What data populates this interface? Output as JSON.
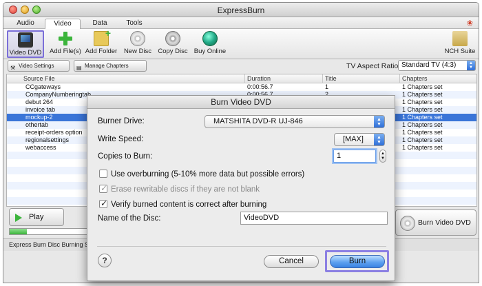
{
  "window": {
    "title": "ExpressBurn"
  },
  "menu": {
    "tabs": [
      {
        "label": "Audio"
      },
      {
        "label": "Video"
      },
      {
        "label": "Data"
      },
      {
        "label": "Tools"
      }
    ],
    "active_tab": "Video"
  },
  "toolbar": {
    "buttons": [
      {
        "label": "Video DVD",
        "icon": "film-icon"
      },
      {
        "label": "Add File(s)",
        "icon": "plus-icon"
      },
      {
        "label": "Add Folder",
        "icon": "folder-icon"
      },
      {
        "label": "New Disc",
        "icon": "disc-icon"
      },
      {
        "label": "Copy Disc",
        "icon": "copy-disc-icon"
      },
      {
        "label": "Buy Online",
        "icon": "globe-icon"
      },
      {
        "label": "NCH Suite",
        "icon": "suite-icon"
      }
    ],
    "selected": "Video DVD"
  },
  "settings": {
    "video_settings_label": "Video Settings",
    "manage_chapters_label": "Manage Chapters",
    "aspect_label": "TV Aspect Ratio:",
    "aspect_value": "Standard TV (4:3)"
  },
  "table": {
    "headers": [
      "Source File",
      "Duration",
      "Title",
      "Chapters"
    ],
    "rows": [
      {
        "source": "CCgateways",
        "duration": "0:00:56.7",
        "title": "1",
        "chapters": "1 Chapters set"
      },
      {
        "source": "CompanyNumberingtab",
        "duration": "0:00:56.7",
        "title": "2",
        "chapters": "1 Chapters set"
      },
      {
        "source": "debut 264",
        "duration": "",
        "title": "",
        "chapters": "1 Chapters set"
      },
      {
        "source": "invoice tab",
        "duration": "",
        "title": "",
        "chapters": "1 Chapters set"
      },
      {
        "source": "mockup-2",
        "duration": "",
        "title": "",
        "chapters": "1 Chapters set"
      },
      {
        "source": "othertab",
        "duration": "",
        "title": "",
        "chapters": "1 Chapters set"
      },
      {
        "source": "receipt-orders option",
        "duration": "",
        "title": "",
        "chapters": "1 Chapters set"
      },
      {
        "source": "regionalsettings",
        "duration": "",
        "title": "",
        "chapters": "1 Chapters set"
      },
      {
        "source": "webaccess",
        "duration": "",
        "title": "",
        "chapters": "1 Chapters set"
      }
    ],
    "selected_row": 4
  },
  "controls": {
    "play_label": "Play",
    "burn_video_dvd_label": "Burn Video DVD",
    "progress_fraction": 0.22
  },
  "status": {
    "text": "Express Burn Disc Burning Softw"
  },
  "dialog": {
    "title": "Burn Video DVD",
    "burner_drive_label": "Burner Drive:",
    "burner_drive_value": "MATSHITA DVD-R   UJ-846",
    "write_speed_label": "Write Speed:",
    "write_speed_value": "[MAX]",
    "copies_label": "Copies to Burn:",
    "copies_value": "1",
    "overburning_label": "Use overburning (5-10% more data but possible errors)",
    "overburning_checked": false,
    "erase_label": "Erase rewritable discs if they are not blank",
    "erase_checked": true,
    "verify_label": "Verify burned content is correct after burning",
    "verify_checked": true,
    "disc_name_label": "Name of the Disc:",
    "disc_name_value": "VideoDVD",
    "help_label": "?",
    "cancel_label": "Cancel",
    "burn_label": "Burn"
  },
  "colors": {
    "highlight": "#8b7fe3",
    "selection": "#3a75d8",
    "default_button": "#5fa2f0"
  }
}
